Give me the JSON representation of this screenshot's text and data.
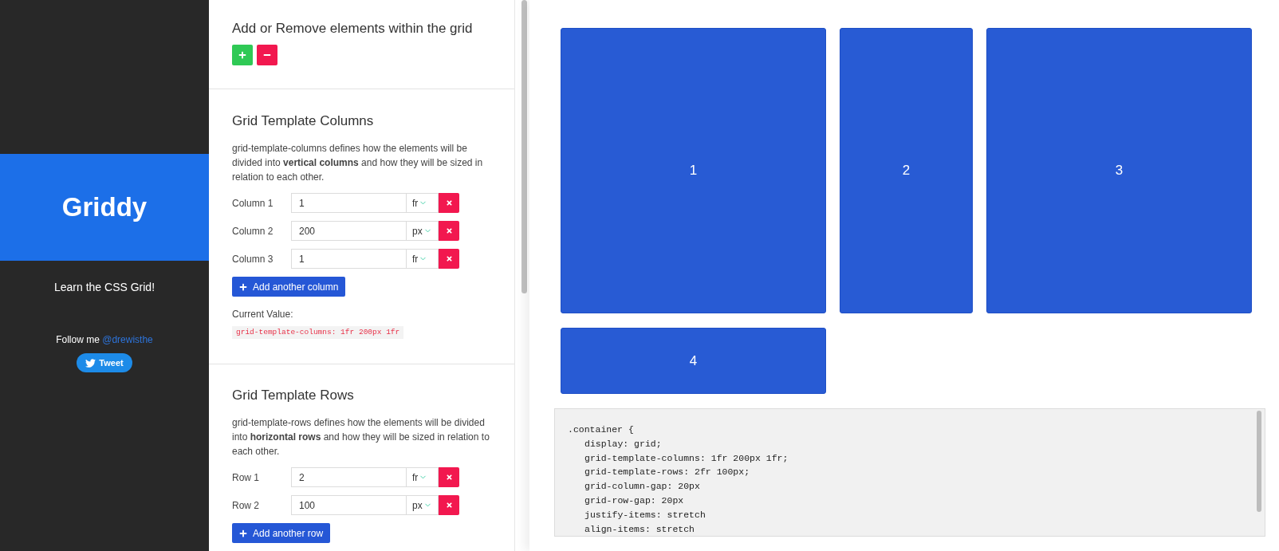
{
  "sidebar": {
    "title": "Griddy",
    "tagline": "Learn the CSS Grid!",
    "follow_text": "Follow me",
    "follow_link": "@drewisthe",
    "tweet_button": "Tweet"
  },
  "elements_section": {
    "title": "Add or Remove elements within the grid",
    "buttons": [
      {
        "kind": "add"
      },
      {
        "kind": "remove"
      }
    ]
  },
  "sections": [
    {
      "title": "Grid Template Columns",
      "description": "grid-template-columns defines how the elements will be divided into **vertical columns** and how they will be sized in relation to each other.",
      "tracks": [
        {
          "label": "Column 1",
          "value": "1",
          "unit": "fr"
        },
        {
          "label": "Column 2",
          "value": "200",
          "unit": "px"
        },
        {
          "label": "Column 3",
          "value": "1",
          "unit": "fr"
        }
      ],
      "add_button": "Add another column",
      "current_value_label": "Current Value:",
      "current_value": "grid-template-columns: 1fr 200px 1fr"
    },
    {
      "title": "Grid Template Rows",
      "description": "grid-template-rows defines how the elements will be divided into **horizontal rows** and how they will be sized in relation to each other.",
      "tracks": [
        {
          "label": "Row 1",
          "value": "2",
          "unit": "fr"
        },
        {
          "label": "Row 2",
          "value": "100",
          "unit": "px"
        }
      ],
      "add_button": "Add another row"
    }
  ],
  "grid": {
    "items": [
      "1",
      "2",
      "3",
      "4"
    ]
  },
  "code": {
    "selector_line": ".container {",
    "declarations": [
      "display: grid;",
      "grid-template-columns: 1fr 200px 1fr;",
      "grid-template-rows: 2fr 100px;",
      "grid-column-gap: 20px",
      "grid-row-gap: 20px",
      "justify-items: stretch",
      "align-items: stretch"
    ]
  }
}
